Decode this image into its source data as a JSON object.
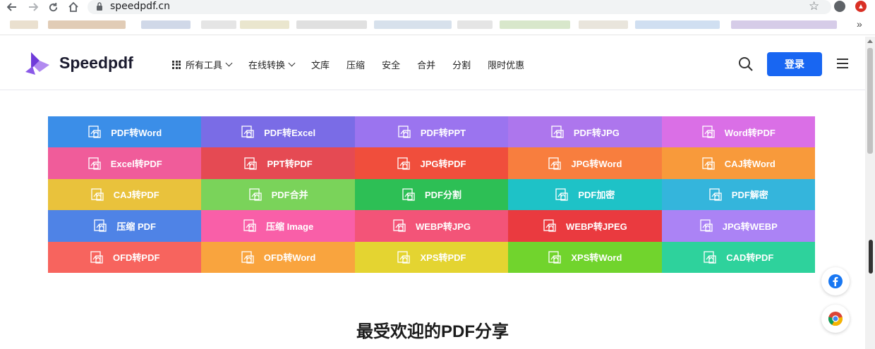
{
  "browser": {
    "url": "speedpdf.cn",
    "back_icon": "arrow-left-icon",
    "forward_icon": "arrow-right-icon",
    "reload_icon": "reload-icon",
    "home_icon": "home-icon",
    "more_bookmarks": "»"
  },
  "header": {
    "logo_text": "Speedpdf",
    "nav": [
      {
        "label": "所有工具",
        "dropdown": true,
        "grid_icon": true
      },
      {
        "label": "在线转换",
        "dropdown": true
      },
      {
        "label": "文库"
      },
      {
        "label": "压缩"
      },
      {
        "label": "安全"
      },
      {
        "label": "合并"
      },
      {
        "label": "分割"
      },
      {
        "label": "限时优惠"
      }
    ],
    "login_label": "登录",
    "brand_color": "#1866f2"
  },
  "tools": [
    {
      "label": "PDF转Word",
      "color": "#3b8ee8"
    },
    {
      "label": "PDF转Excel",
      "color": "#7a6ce6"
    },
    {
      "label": "PDF转PPT",
      "color": "#9b74ef"
    },
    {
      "label": "PDF转JPG",
      "color": "#ad76ed"
    },
    {
      "label": "Word转PDF",
      "color": "#da6fe6"
    },
    {
      "label": "Excel转PDF",
      "color": "#f05c9a"
    },
    {
      "label": "PPT转PDF",
      "color": "#e54a53"
    },
    {
      "label": "JPG转PDF",
      "color": "#f04e3c"
    },
    {
      "label": "JPG转Word",
      "color": "#f87e3e"
    },
    {
      "label": "CAJ转Word",
      "color": "#f89a3b"
    },
    {
      "label": "CAJ转PDF",
      "color": "#e9c23c"
    },
    {
      "label": "PDF合并",
      "color": "#7ad35a"
    },
    {
      "label": "PDF分割",
      "color": "#2dbf55"
    },
    {
      "label": "PDF加密",
      "color": "#1ec2c7"
    },
    {
      "label": "PDF解密",
      "color": "#34b5dc"
    },
    {
      "label": "压缩 PDF",
      "color": "#4f83e6"
    },
    {
      "label": "压缩 Image",
      "color": "#f95fa8"
    },
    {
      "label": "WEBP转JPG",
      "color": "#f35478"
    },
    {
      "label": "WEBP转JPEG",
      "color": "#ea3a3f"
    },
    {
      "label": "JPG转WEBP",
      "color": "#ab83f5"
    },
    {
      "label": "OFD转PDF",
      "color": "#f7645e"
    },
    {
      "label": "OFD转Word",
      "color": "#f9a43e"
    },
    {
      "label": "XPS转PDF",
      "color": "#e4d431"
    },
    {
      "label": "XPS转Word",
      "color": "#71d42d"
    },
    {
      "label": "CAD转PDF",
      "color": "#2ed29c"
    }
  ],
  "headline": "最受欢迎的PDF分享",
  "floating": [
    {
      "icon": "facebook-icon",
      "color": "#1877f2"
    },
    {
      "icon": "chrome-icon",
      "color": "#db4437"
    }
  ]
}
